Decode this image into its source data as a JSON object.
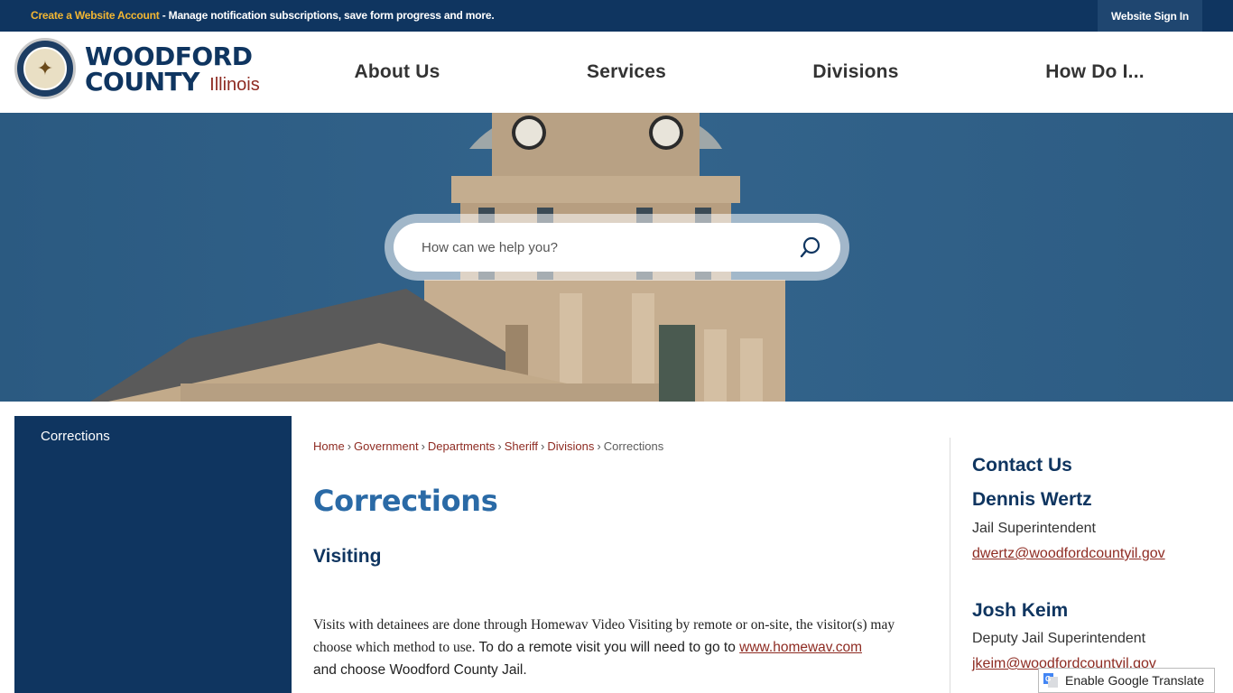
{
  "topbar": {
    "create_account_link": "Create a Website Account",
    "create_account_desc": " - Manage notification subscriptions, save form progress and more.",
    "sign_in": "Website Sign In"
  },
  "brand": {
    "line1": "WOODFORD",
    "line2": "COUNTY",
    "state": "Illinois"
  },
  "nav": [
    "About Us",
    "Services",
    "Divisions",
    "How Do I..."
  ],
  "search": {
    "placeholder": "How can we help you?"
  },
  "sidebar": {
    "items": [
      {
        "label": "Corrections"
      }
    ]
  },
  "breadcrumb": [
    "Home",
    "Government",
    "Departments",
    "Sheriff",
    "Divisions",
    "Corrections"
  ],
  "page": {
    "title": "Corrections",
    "subtitle": "Visiting",
    "para_serif": " Visits with detainees are done through Homewav Video Visiting by remote or on-site, the visitor(s) may choose which method to use.",
    "para_sans_1": "  To do a remote visit you will need to go to ",
    "link": "www.homewav.com",
    "para_sans_2": "and choose Woodford County Jail."
  },
  "contact": {
    "title": "Contact Us",
    "people": [
      {
        "name": "Dennis Wertz",
        "role": "Jail Superintendent",
        "email": "dwertz@woodfordcountyil.gov"
      },
      {
        "name": "Josh Keim",
        "role": "Deputy Jail Superintendent",
        "email": "jkeim@woodfordcountyil.gov"
      }
    ]
  },
  "translate": {
    "label": "Enable Google Translate"
  },
  "colors": {
    "navy": "#0f3560",
    "accent_gold": "#f2b632",
    "link_red": "#8e2b22",
    "title_blue": "#2a6aa6"
  }
}
